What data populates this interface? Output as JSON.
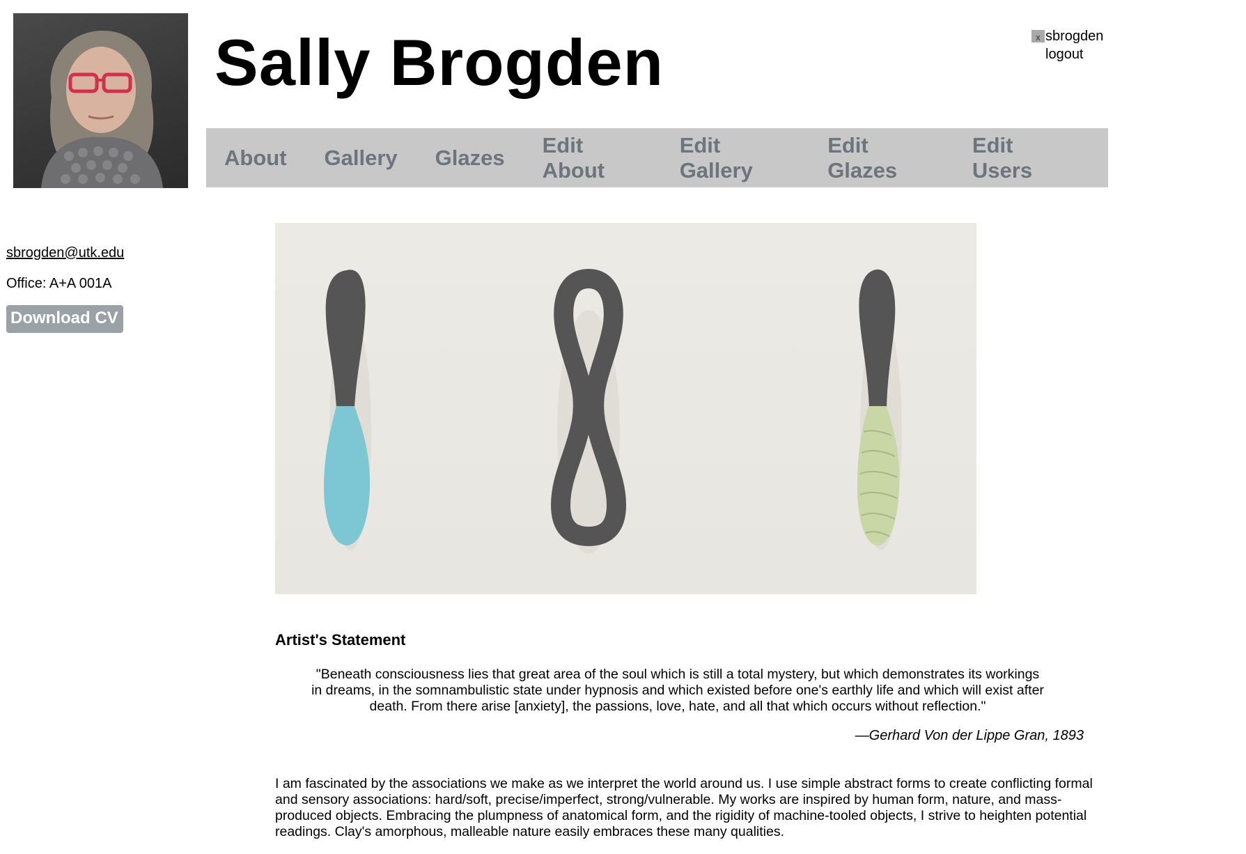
{
  "header": {
    "site_title": "Sally Brogden",
    "avatar_alt": "Sally Brogden portrait"
  },
  "user": {
    "broken_icon_glyph": "x",
    "username": "sbrogden",
    "logout_label": "logout"
  },
  "nav": {
    "items": [
      {
        "label": "About"
      },
      {
        "label": "Gallery"
      },
      {
        "label": "Glazes"
      },
      {
        "label": "Edit About"
      },
      {
        "label": "Edit Gallery"
      },
      {
        "label": "Edit Glazes"
      },
      {
        "label": "Edit Users"
      }
    ]
  },
  "sidebar": {
    "email": "sbrogden@utk.edu",
    "office": "Office: A+A 001A",
    "cv_button": "Download CV"
  },
  "main": {
    "hero_alt": "Three ceramic wall sculptures",
    "statement_heading": "Artist's Statement",
    "quote": "\"Beneath consciousness lies that great area of the soul which is still a total mystery, but which demonstrates its workings in dreams, in the somnambulistic state under hypnosis and which existed before one's earthly life and which will exist after death. From there arise [anxiety], the passions, love, hate, and all that which occurs without reflection.\"",
    "attribution": "—Gerhard Von der Lippe Gran, 1893",
    "body": "I am fascinated by the associations we make as we interpret the world around us. I use simple abstract forms to create conflicting formal and sensory associations: hard/soft, precise/imperfect, strong/vulnerable. My works are inspired by human form, nature, and mass-produced objects. Embracing the plumpness of anatomical form, and the rigidity of machine-tooled objects, I strive to heighten potential readings. Clay's amorphous, malleable nature easily embraces these many qualities."
  },
  "colors": {
    "nav_bg": "#c8c8c8",
    "nav_text": "#6c757d",
    "cv_button_bg": "#9aa1a7",
    "sculpture_dark": "#555555",
    "sculpture_blue": "#7cc7d3",
    "sculpture_green": "#c9d6a6"
  }
}
